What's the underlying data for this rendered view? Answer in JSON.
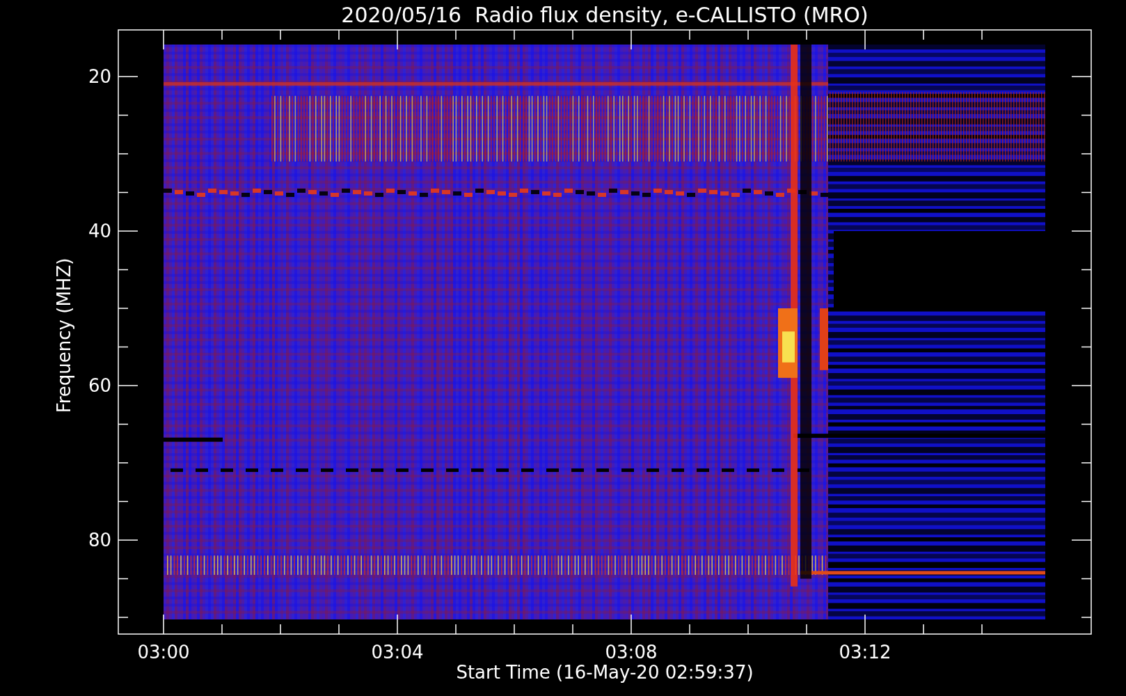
{
  "title": "2020/05/16  Radio flux density, e-CALLISTO (MRO)",
  "y_axis": {
    "label": "Frequency (MHZ)",
    "ticks": [
      "20",
      "40",
      "60",
      "80"
    ]
  },
  "x_axis": {
    "label": "Start Time (16-May-20 02:59:37)",
    "ticks": [
      "03:00",
      "03:04",
      "03:08",
      "03:12"
    ]
  }
}
